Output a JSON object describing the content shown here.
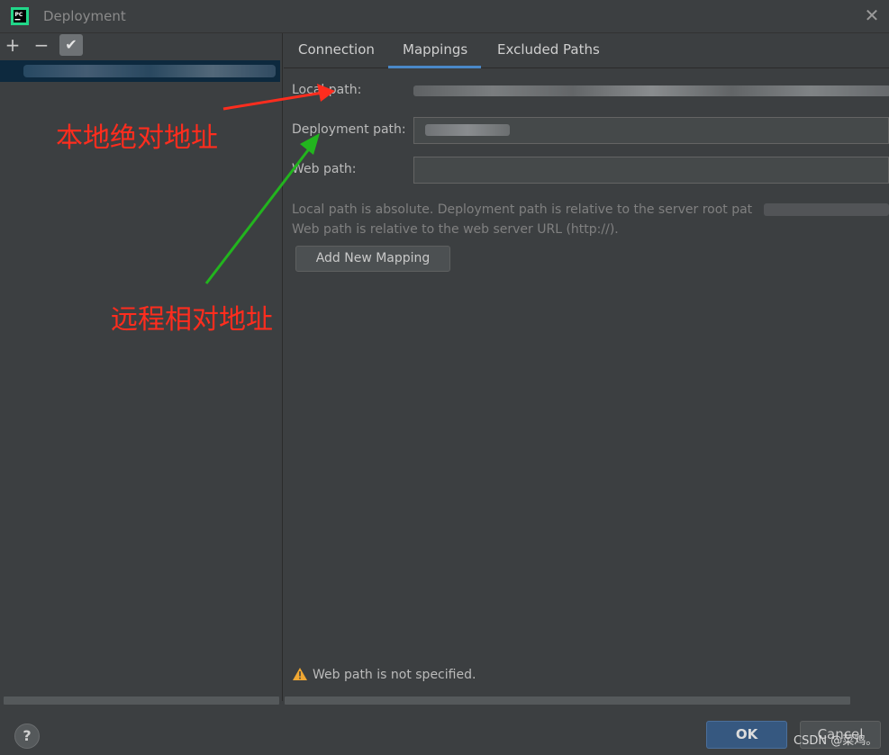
{
  "window": {
    "title": "Deployment",
    "close_glyph": "✕"
  },
  "toolbar": {
    "add": "+",
    "remove": "−",
    "check": "✔"
  },
  "tabs": [
    {
      "label": "Connection",
      "active": false
    },
    {
      "label": "Mappings",
      "active": true
    },
    {
      "label": "Excluded Paths",
      "active": false
    }
  ],
  "mappings": {
    "local_path_label": "Local path:",
    "deployment_path_label": "Deployment path:",
    "web_path_label": "Web path:",
    "info_line1": "Local path is absolute. Deployment path is relative to the server root pat",
    "info_line2": "Web path is relative to the web server URL (http://).",
    "add_button": "Add New Mapping"
  },
  "annotations": {
    "local": "本地绝对地址",
    "remote": "远程相对地址",
    "colors": {
      "red": "#ff2d1e",
      "green": "#22b51e"
    }
  },
  "warning": {
    "text": "Web path is not specified.",
    "icon": "warning-icon",
    "color": "#f0a732"
  },
  "footer": {
    "help": "?",
    "ok": "OK",
    "cancel": "Cancel",
    "watermark": "CSDN @菜鸡。"
  },
  "colors": {
    "accent": "#4a88c7",
    "ok_button": "#365880",
    "background": "#3c3f41"
  }
}
